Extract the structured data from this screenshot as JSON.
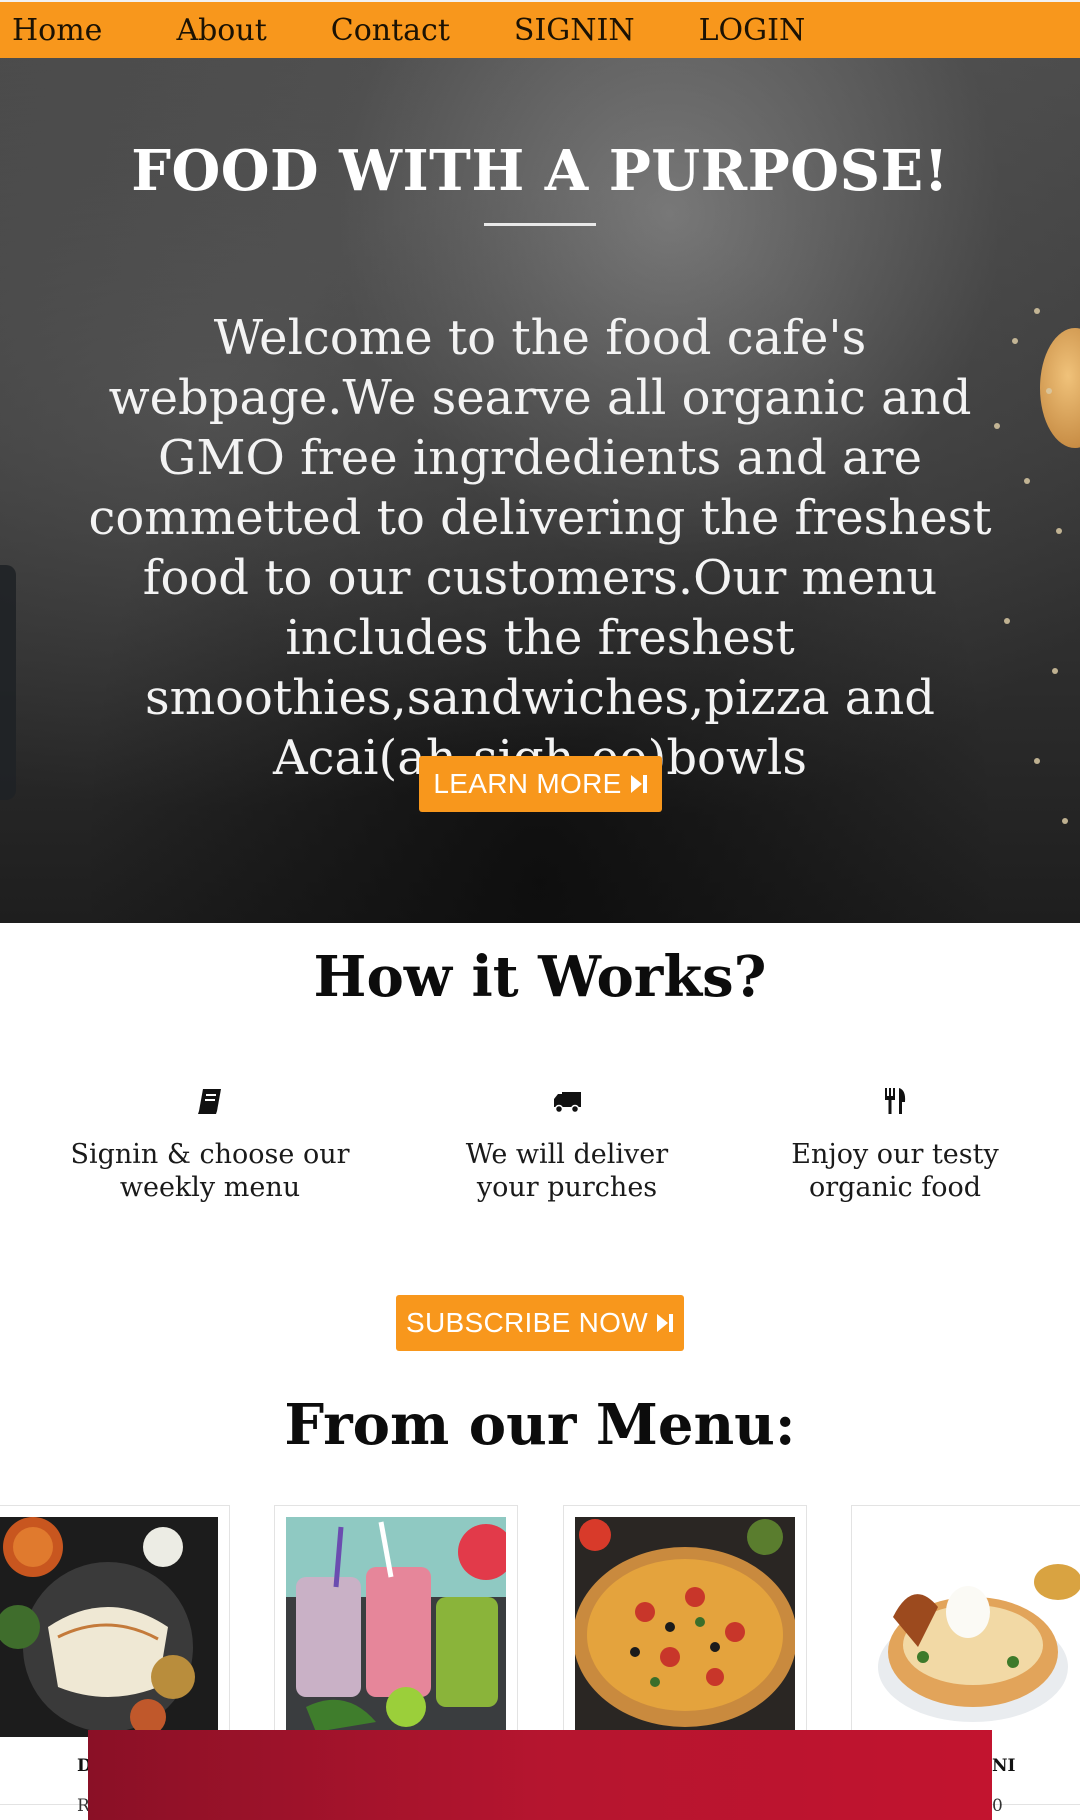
{
  "nav": {
    "items": [
      "Home",
      "About",
      "Contact",
      "SIGNIN",
      "LOGIN"
    ]
  },
  "hero": {
    "title": "FOOD WITH A PURPOSE!",
    "text": "Welcome to the food cafe's webpage.We searve all organic and GMO free ingrdedients and are commetted to delivering the freshest food to our customers.Our menu includes the freshest smoothies,sandwiches,pizza and Acai(ah-sigh-ee)bowls",
    "button_label": "LEARN MORE"
  },
  "how": {
    "title": "How it Works?",
    "steps": [
      {
        "icon": "book-icon",
        "line1": "Signin & choose our",
        "line2": "weekly menu"
      },
      {
        "icon": "truck-icon",
        "line1": "We will deliver",
        "line2": "your purches"
      },
      {
        "icon": "utensils-icon",
        "line1": "Enjoy our testy",
        "line2": "organic food"
      }
    ],
    "button_label": "SUBSCRIBE NOW"
  },
  "menu": {
    "title": "From our Menu:",
    "cards": [
      {
        "label": "D",
        "sub": "R"
      },
      {
        "label": "",
        "sub": ""
      },
      {
        "label": "",
        "sub": ""
      },
      {
        "label": "NI",
        "sub": "0"
      }
    ]
  },
  "colors": {
    "accent": "#f8971c",
    "overlay": "#b5152f"
  }
}
